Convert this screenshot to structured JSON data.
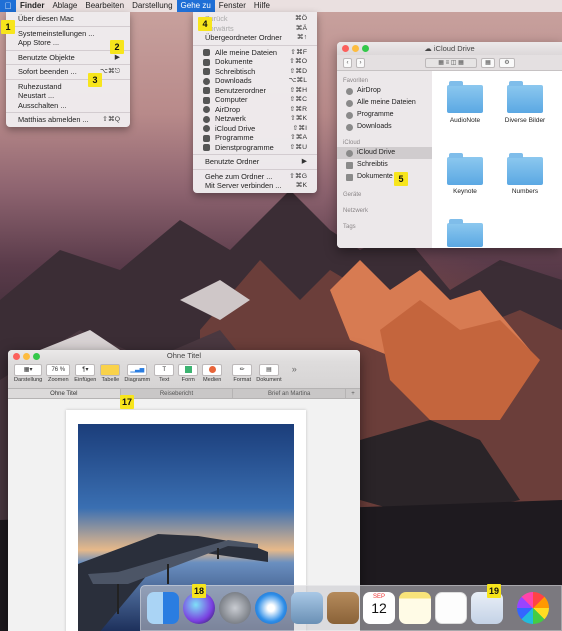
{
  "menubar": {
    "items": [
      "Finder",
      "Ablage",
      "Bearbeiten",
      "Darstellung",
      "Gehe zu",
      "Fenster",
      "Hilfe"
    ]
  },
  "apple_menu": {
    "items": [
      {
        "label": "Über diesen Mac",
        "shortcut": ""
      },
      {
        "label": "Systemeinstellungen ...",
        "shortcut": ""
      },
      {
        "label": "App Store ...",
        "shortcut": ""
      },
      {
        "label": "Benutzte Objekte",
        "shortcut": "▶"
      },
      {
        "label": "Sofort beenden ...",
        "shortcut": "⌥⌘⎋"
      },
      {
        "label": "Ruhezustand",
        "shortcut": ""
      },
      {
        "label": "Neustart ...",
        "shortcut": ""
      },
      {
        "label": "Ausschalten ...",
        "shortcut": ""
      },
      {
        "label": "Matthias abmelden ...",
        "shortcut": "⇧⌘Q"
      }
    ]
  },
  "go_menu": {
    "items": [
      {
        "label": "Zurück",
        "shortcut": "⌘Ö"
      },
      {
        "label": "Vorwärts",
        "shortcut": "⌘Ä"
      },
      {
        "label": "Übergeordneter Ordner",
        "shortcut": "⌘↑"
      },
      {
        "label": "Alle meine Dateien",
        "shortcut": "⇧⌘F"
      },
      {
        "label": "Dokumente",
        "shortcut": "⇧⌘O"
      },
      {
        "label": "Schreibtisch",
        "shortcut": "⇧⌘D"
      },
      {
        "label": "Downloads",
        "shortcut": "⌥⌘L"
      },
      {
        "label": "Benutzerordner",
        "shortcut": "⇧⌘H"
      },
      {
        "label": "Computer",
        "shortcut": "⇧⌘C"
      },
      {
        "label": "AirDrop",
        "shortcut": "⇧⌘R"
      },
      {
        "label": "Netzwerk",
        "shortcut": "⇧⌘K"
      },
      {
        "label": "iCloud Drive",
        "shortcut": "⇧⌘I"
      },
      {
        "label": "Programme",
        "shortcut": "⇧⌘A"
      },
      {
        "label": "Dienstprogramme",
        "shortcut": "⇧⌘U"
      },
      {
        "label": "Benutzte Ordner",
        "shortcut": "▶"
      },
      {
        "label": "Gehe zum Ordner ...",
        "shortcut": "⇧⌘G"
      },
      {
        "label": "Mit Server verbinden ...",
        "shortcut": "⌘K"
      }
    ]
  },
  "badges": [
    "1",
    "2",
    "3",
    "4",
    "5",
    "17",
    "18",
    "19"
  ],
  "finder": {
    "title": "iCloud Drive",
    "sidebar": {
      "favorites_heading": "Favoriten",
      "favorites": [
        "AirDrop",
        "Alle meine Dateien",
        "Programme",
        "Downloads"
      ],
      "icloud_heading": "iCloud",
      "icloud": [
        "iCloud Drive",
        "Schreibtis",
        "Dokumente"
      ],
      "devices_heading": "Geräte",
      "network_heading": "Netzwerk",
      "tags_heading": "Tags"
    },
    "items": [
      "AudioNote",
      "Diverse Bilder",
      "Keynote",
      "Numbers"
    ]
  },
  "pages": {
    "title": "Ohne Titel",
    "zoom": "76 %",
    "toolbar": [
      "Darstellung",
      "Zoomen",
      "Einfügen",
      "Tabelle",
      "Diagramm",
      "Text",
      "Form",
      "Medien",
      "Format",
      "Dokument"
    ],
    "tabs": [
      "Ohne Titel",
      "Reisebericht",
      "Brief an Martina"
    ],
    "more": "»",
    "plus": "+"
  },
  "dock": {
    "calendar_month": "SEP",
    "calendar_day": "12"
  }
}
